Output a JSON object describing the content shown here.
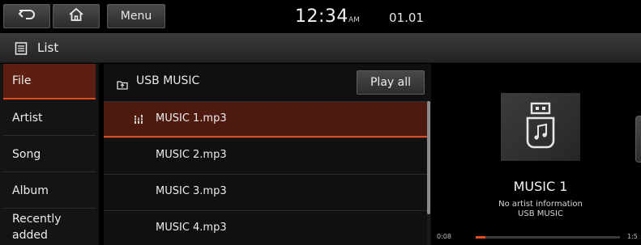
{
  "header": {
    "menu_label": "Menu",
    "time": "12:34",
    "ampm": "AM",
    "date": "01.01",
    "back_icon": "back-arrow-icon",
    "home_icon": "home-icon"
  },
  "titlebar": {
    "title": "List",
    "icon": "list-icon"
  },
  "categories": [
    {
      "label": "File",
      "active": true
    },
    {
      "label": "Artist",
      "active": false
    },
    {
      "label": "Song",
      "active": false
    },
    {
      "label": "Album",
      "active": false
    },
    {
      "label": "Recently added",
      "line1": "Recently",
      "line2": "added",
      "active": false
    }
  ],
  "filelist": {
    "folder_label": "USB MUSIC",
    "play_all_label": "Play all",
    "tracks": [
      {
        "name": "MUSIC 1.mp3",
        "active": true
      },
      {
        "name": "MUSIC 2.mp3",
        "active": false
      },
      {
        "name": "MUSIC 3.mp3",
        "active": false
      },
      {
        "name": "MUSIC 4.mp3",
        "active": false
      }
    ]
  },
  "nowplaying": {
    "title": "MUSIC 1",
    "artist": "No artist information",
    "folder": "USB MUSIC",
    "current_time": "0:08",
    "total_time": "1:5",
    "progress": 0.07
  },
  "colors": {
    "accent": "#e04a1f",
    "active_bg": "#5e1f13"
  }
}
